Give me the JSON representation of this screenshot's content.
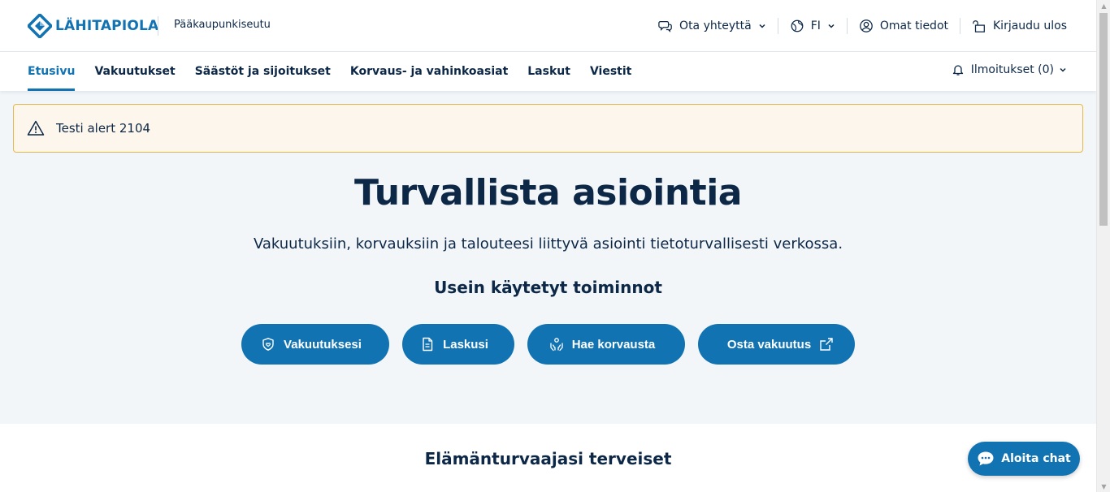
{
  "header": {
    "brand": "LÄHITAPIOLA",
    "region": "Pääkaupunkiseutu",
    "contact_label": "Ota yhteyttä",
    "language_label": "FI",
    "profile_label": "Omat tiedot",
    "logout_label": "Kirjaudu ulos"
  },
  "nav": {
    "items": [
      {
        "label": "Etusivu",
        "active": true
      },
      {
        "label": "Vakuutukset"
      },
      {
        "label": "Säästöt ja sijoitukset"
      },
      {
        "label": "Korvaus- ja vahinkoasiat"
      },
      {
        "label": "Laskut"
      },
      {
        "label": "Viestit"
      }
    ],
    "notifications_label": "Ilmoitukset (0)"
  },
  "alert": {
    "text": "Testi alert 2104"
  },
  "hero": {
    "title": "Turvallista asiointia",
    "subtitle": "Vakuutuksiin, korvauksiin ja talouteesi liittyvä asiointi tietoturvallisesti verkossa.",
    "section_title": "Usein käytetyt toiminnot",
    "actions": [
      {
        "label": "Vakuutuksesi",
        "icon": "shield-icon"
      },
      {
        "label": "Laskusi",
        "icon": "document-icon"
      },
      {
        "label": "Hae korvausta",
        "icon": "hands-icon"
      },
      {
        "label": "Osta vakuutus",
        "icon": "external-link-icon"
      }
    ]
  },
  "lower": {
    "title": "Elämänturvaajasi terveiset"
  },
  "chat": {
    "label": "Aloita chat"
  },
  "colors": {
    "brand": "#1273b3",
    "text": "#0d2847",
    "hero_bg": "#f2f6f9",
    "alert_bg": "#fdf6ec",
    "alert_border": "#e6b84c"
  }
}
